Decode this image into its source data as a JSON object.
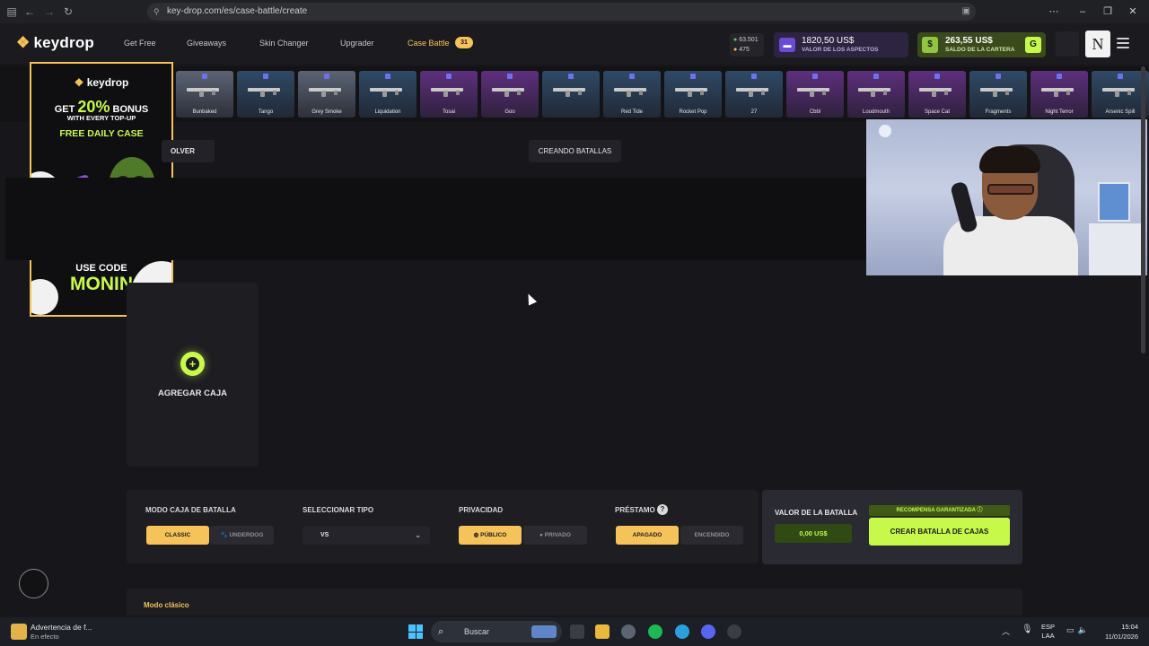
{
  "browser": {
    "url": "key-drop.com/es/case-battle/create"
  },
  "header": {
    "logo": "keydrop",
    "nav": [
      "Get Free",
      "Giveaways",
      "Skin Changer",
      "Upgrader",
      "Case Battle"
    ],
    "case_battle_count": "31",
    "coins_green": "63.501",
    "coins_gold": "475",
    "skins_value": "1820,50 US$",
    "skins_value_label": "VALOR DE LOS ASPECTOS",
    "wallet_value": "263,55 US$",
    "wallet_label": "SALDO DE LA CARTERA"
  },
  "drops": [
    {
      "name": "Bunbaked",
      "bg": "#5b6474"
    },
    {
      "name": "Tango",
      "bg": "#2f4a66"
    },
    {
      "name": "Grey Smoke",
      "bg": "#5b6474"
    },
    {
      "name": "Liquidation",
      "bg": "#2f4a66"
    },
    {
      "name": "Tosai",
      "bg": "#5e2f7e"
    },
    {
      "name": "Goo",
      "bg": "#5e2f7e"
    },
    {
      "name": "",
      "bg": "#2f4a66"
    },
    {
      "name": "Red Tide",
      "bg": "#2f4a66"
    },
    {
      "name": "Rocket Pop",
      "bg": "#2f4a66"
    },
    {
      "name": "27",
      "bg": "#2f4a66"
    },
    {
      "name": "Cbbl",
      "bg": "#5e2f7e"
    },
    {
      "name": "Loudmouth",
      "bg": "#5e2f7e"
    },
    {
      "name": "Space Cat",
      "bg": "#5e2f7e"
    },
    {
      "name": "Fragments",
      "bg": "#2f4a66"
    },
    {
      "name": "Night Terror",
      "bg": "#5e2f7e"
    },
    {
      "name": "Arsenic Spill",
      "bg": "#2f4a66"
    }
  ],
  "promo": {
    "brand": "keydrop",
    "line1_pre": "GET",
    "line1_pct": "20%",
    "line1_post": "BONUS",
    "line2": "WITH EVERY TOP-UP",
    "line3": "FREE DAILY CASE",
    "use_code": "USE CODE",
    "code": "MONIN"
  },
  "toolbar": {
    "back": "OLVER",
    "creating": "CREANDO BATALLAS"
  },
  "add_case": {
    "label": "AGREGAR CAJA"
  },
  "settings": {
    "mode_label": "MODO CAJA DE BATALLA",
    "mode_options": [
      "CLASSIC",
      "UNDERDOG"
    ],
    "type_label": "SELECCIONAR TIPO",
    "type_value": "VS",
    "privacy_label": "PRIVACIDAD",
    "privacy_options": [
      "PÚBLICO",
      "PRIVADO"
    ],
    "loan_label": "PRÉSTAMO",
    "loan_options": [
      "APAGADO",
      "ENCENDIDO"
    ]
  },
  "battle": {
    "value_label": "VALOR DE LA BATALLA",
    "value": "0,00 US$",
    "guaranteed": "RECOMPENSA GARANTIZADA",
    "create": "CREAR BATALLA DE CAJAS"
  },
  "mode_section": "Modo clásico",
  "taskbar": {
    "warning_title": "Advertencia de f...",
    "warning_sub": "En efecto",
    "search": "Buscar",
    "lang_1": "ESP",
    "lang_2": "LAA",
    "time": "15:04",
    "date": "11/01/2026"
  }
}
